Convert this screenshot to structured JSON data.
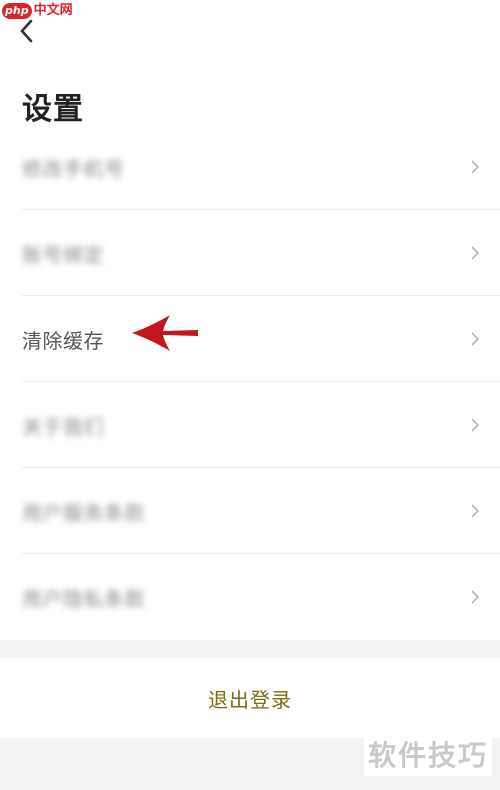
{
  "watermark": {
    "logo_text": "php",
    "site_text": "中文网",
    "bottom_text": "软件技巧"
  },
  "header": {
    "back_icon": "chevron-left-icon",
    "title": "设置"
  },
  "settings": {
    "items": [
      {
        "label": "修改手机号",
        "blurred": true
      },
      {
        "label": "账号绑定",
        "blurred": true
      },
      {
        "label": "清除缓存",
        "blurred": false
      },
      {
        "label": "关于我们",
        "blurred": true
      },
      {
        "label": "用户服务条款",
        "blurred": true
      },
      {
        "label": "用户隐私条款",
        "blurred": true
      }
    ],
    "row_icon": "chevron-right-icon"
  },
  "annotation": {
    "icon": "red-arrow-left-icon",
    "color": "#c0171e"
  },
  "logout": {
    "label": "退出登录",
    "color": "#7a6d12"
  }
}
